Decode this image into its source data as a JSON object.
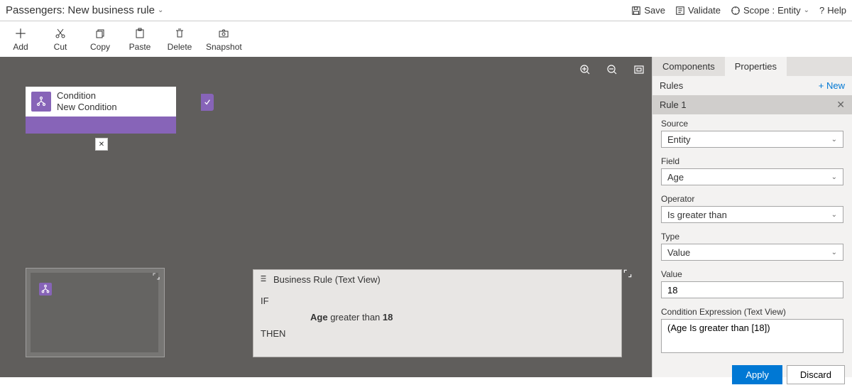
{
  "header": {
    "entity": "Passengers:",
    "title": "New business rule",
    "save": "Save",
    "validate": "Validate",
    "scope_label": "Scope :",
    "scope_value": "Entity",
    "help": "Help"
  },
  "toolbar": {
    "add": "Add",
    "cut": "Cut",
    "copy": "Copy",
    "paste": "Paste",
    "delete": "Delete",
    "snapshot": "Snapshot"
  },
  "node": {
    "type": "Condition",
    "name": "New Condition"
  },
  "textview": {
    "title": "Business Rule (Text View)",
    "if": "IF",
    "then": "THEN",
    "field": "Age",
    "op": "greater than",
    "val": "18"
  },
  "panel": {
    "tab_components": "Components",
    "tab_properties": "Properties",
    "rules_label": "Rules",
    "new_label": "+ New",
    "rule_name": "Rule 1",
    "source_label": "Source",
    "source_value": "Entity",
    "field_label": "Field",
    "field_value": "Age",
    "operator_label": "Operator",
    "operator_value": "Is greater than",
    "type_label": "Type",
    "type_value": "Value",
    "value_label": "Value",
    "value_value": "18",
    "expr_label": "Condition Expression (Text View)",
    "expr_value": "(Age Is greater than [18])",
    "apply": "Apply",
    "discard": "Discard"
  }
}
